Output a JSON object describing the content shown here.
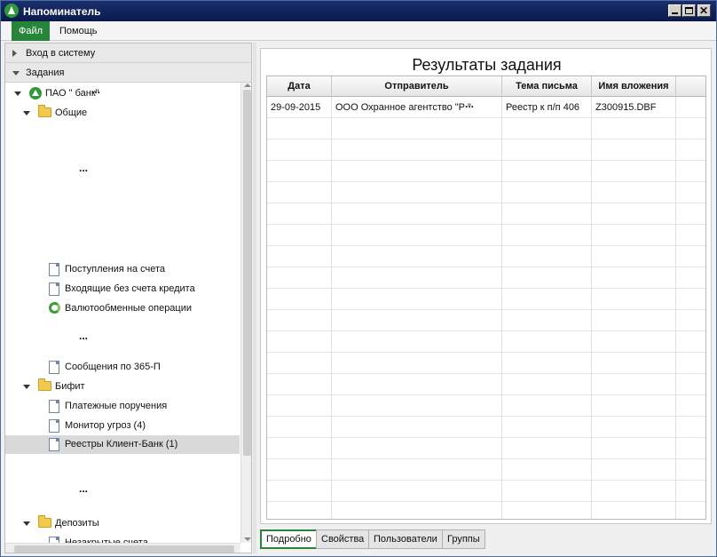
{
  "window": {
    "title": "Напоминатель"
  },
  "menu": {
    "file": "Файл",
    "help": "Помощь"
  },
  "sidebar": {
    "login_section": "Вход в систему",
    "tasks_section": "Задания",
    "tree": {
      "bank": "ПАО \"        банк\"",
      "bank_ellipsis": "...",
      "general": "Общие",
      "general_ellipsis": "...",
      "incoming_accounts": "Поступления на счета",
      "incoming_no_credit": "Входящие без счета кредита",
      "currency_exchange": "Валютообменные операции",
      "mid_ellipsis": "...",
      "messages_365p": "Сообщения по 365-П",
      "bifit": "Бифит",
      "payment_orders": "Платежные поручения",
      "threat_monitor": "Монитор угроз (4)",
      "client_bank_registries": "Реестры Клиент-Банк (1)",
      "lower_ellipsis": "...",
      "deposits": "Депозиты",
      "unclosed_accounts": "Незакрытые счета"
    }
  },
  "results": {
    "title": "Результаты задания",
    "columns": [
      "Дата",
      "Отправитель",
      "Тема письма",
      "Имя вложения"
    ],
    "rows": [
      {
        "date": "29-09-2015",
        "sender": "ООО Охранное агентство \"Р          \"",
        "sender_ellipsis": "...",
        "subject": "Реестр к п/п 406",
        "attachment": "Z300915.DBF"
      }
    ]
  },
  "tabs": [
    "Подробно",
    "Свойства",
    "Пользователи",
    "Группы"
  ],
  "colors": {
    "accent": "#27853a",
    "titlebar": "#0a1a4e",
    "selection": "#d9d9d9"
  },
  "icons": {
    "app": "app-logo-icon",
    "folder": "folder-icon",
    "document": "document-icon",
    "exchange": "exchange-icon"
  }
}
